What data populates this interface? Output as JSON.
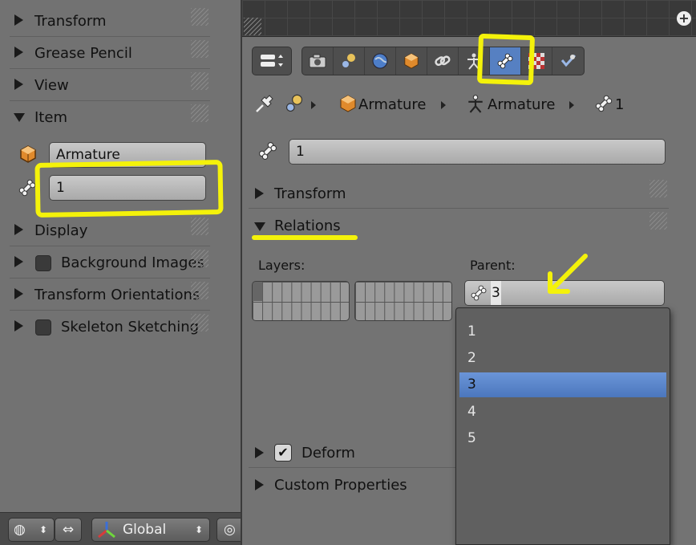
{
  "left_panel": {
    "sections": [
      "Transform",
      "Grease Pencil",
      "View",
      "Item",
      "Display",
      "Background Images",
      "Transform Orientations",
      "Skeleton Sketching"
    ],
    "item_object_name": "Armature",
    "item_bone_name": "1"
  },
  "properties": {
    "breadcrumb": [
      "Armature",
      "Armature",
      "1"
    ],
    "bone_name": "1",
    "sections": [
      "Transform",
      "Relations",
      "Deform",
      "Custom Properties"
    ],
    "layers_label": "Layers:",
    "parent_label": "Parent:",
    "parent_value": "3",
    "deform_checked": true,
    "tabs": [
      "render-icon",
      "scene-icon",
      "world-icon",
      "object-icon",
      "constraints-icon",
      "armature-data-icon",
      "bone-icon",
      "material-icon",
      "bone-constraints-icon"
    ],
    "active_tab": "bone-icon"
  },
  "dropdown": {
    "items": [
      "1",
      "2",
      "3",
      "4",
      "5"
    ],
    "selected": "3"
  },
  "bottom_bar": {
    "orientation": "Global"
  },
  "colors": {
    "highlight": "#f4f20a",
    "selection": "#5680c2",
    "object_orange": "#e08a2c"
  }
}
